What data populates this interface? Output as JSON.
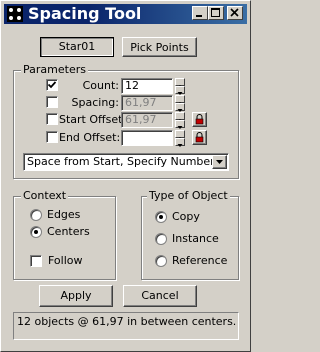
{
  "window": {
    "title": "Spacing Tool"
  },
  "top_buttons": {
    "object": "Star01",
    "pick_points": "Pick Points"
  },
  "parameters": {
    "legend": "Parameters",
    "count": {
      "label": "Count:",
      "value": "12",
      "checked": true
    },
    "spacing": {
      "label": "Spacing:",
      "value": "61,97",
      "checked": false
    },
    "start_offset": {
      "label": "Start Offset:",
      "value": "61,97",
      "checked": false
    },
    "end_offset": {
      "label": "End Offset:",
      "value": "",
      "checked": false
    },
    "mode": "Space from Start, Specify Number"
  },
  "context": {
    "legend": "Context",
    "options": [
      "Edges",
      "Centers"
    ],
    "selected": "Centers",
    "follow_label": "Follow"
  },
  "type_of_object": {
    "legend": "Type of Object",
    "options": [
      "Copy",
      "Instance",
      "Reference"
    ],
    "selected": "Copy"
  },
  "actions": {
    "apply": "Apply",
    "cancel": "Cancel"
  },
  "status": "12 objects @ 61,97 in between centers.",
  "colors": {
    "titlebar": "#0a246a",
    "face": "#d4d0c8"
  }
}
